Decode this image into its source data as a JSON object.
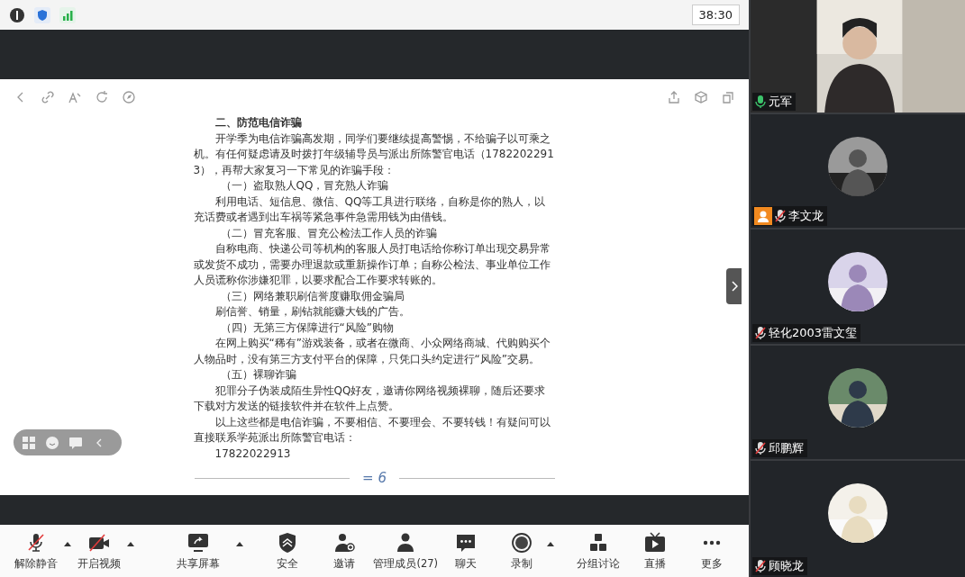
{
  "status_bar": {
    "timer": "38:30"
  },
  "document": {
    "paragraphs": [
      {
        "kind": "heading",
        "text": "二、防范电信诈骗"
      },
      {
        "kind": "body",
        "text": "开学季为电信诈骗高发期，同学们要继续提高警惕，不给骗子以可乘之机。有任何疑虑请及时拨打年级辅导员与派出所陈警官电话（17822022913），再帮大家复习一下常见的诈骗手段："
      },
      {
        "kind": "subheading",
        "text": "（一）盗取熟人QQ，冒充熟人诈骗"
      },
      {
        "kind": "body",
        "text": "利用电话、短信息、微信、QQ等工具进行联络，自称是你的熟人，以充话费或者遇到出车祸等紧急事件急需用钱为由借钱。"
      },
      {
        "kind": "subheading",
        "text": "（二）冒充客服、冒充公检法工作人员的诈骗"
      },
      {
        "kind": "body",
        "text": "自称电商、快递公司等机构的客服人员打电话给你称订单出现交易异常或发货不成功，需要办理退款或重新操作订单；自称公检法、事业单位工作人员谎称你涉嫌犯罪，以要求配合工作要求转账的。"
      },
      {
        "kind": "subheading",
        "text": "（三）网络兼职刷信誉度赚取佣金骗局"
      },
      {
        "kind": "plain",
        "text": "刷信誉、销量，刷钻就能赚大钱的广告。"
      },
      {
        "kind": "subheading",
        "text": "（四）无第三方保障进行“风险”购物"
      },
      {
        "kind": "body",
        "text": "在网上购买“稀有”游戏装备，或者在微商、小众网络商城、代购购买个人物品时，没有第三方支付平台的保障，只凭口头约定进行“风险”交易。"
      },
      {
        "kind": "subheading",
        "text": "（五）裸聊诈骗"
      },
      {
        "kind": "body",
        "text": "犯罪分子伪装成陌生异性QQ好友，邀请你网络视频裸聊，随后还要求下载对方发送的链接软件并在软件上点赞。"
      },
      {
        "kind": "body",
        "text": "以上这些都是电信诈骗，不要相信、不要理会、不要转钱！有疑问可以直接联系学苑派出所陈警官电话："
      },
      {
        "kind": "plain",
        "text": "17822022913"
      }
    ],
    "page_number": "= 6"
  },
  "toolbar": [
    {
      "kind": "button",
      "label": "解除静音"
    },
    {
      "kind": "caret"
    },
    {
      "kind": "button",
      "label": "开启视频"
    },
    {
      "kind": "caret"
    },
    {
      "kind": "button",
      "label": "共享屏幕"
    },
    {
      "kind": "caret"
    },
    {
      "kind": "button",
      "label": "安全"
    },
    {
      "kind": "button",
      "label": "邀请"
    },
    {
      "kind": "button",
      "label": "管理成员(27)"
    },
    {
      "kind": "button",
      "label": "聊天"
    },
    {
      "kind": "button",
      "label": "录制"
    },
    {
      "kind": "caret"
    },
    {
      "kind": "button",
      "label": "分组讨论"
    },
    {
      "kind": "button",
      "label": "直播"
    },
    {
      "kind": "button",
      "label": "更多"
    }
  ],
  "participants": [
    {
      "kind": "video",
      "name": "元军",
      "muted": false,
      "host": false
    },
    {
      "kind": "avatar",
      "name": "李文龙",
      "muted": true,
      "host": true
    },
    {
      "kind": "avatar",
      "name": "轻化2003雷文玺",
      "muted": true,
      "host": false
    },
    {
      "kind": "avatar",
      "name": "邱鹏辉",
      "muted": true,
      "host": false
    },
    {
      "kind": "avatar",
      "name": "顾晓龙",
      "muted": true,
      "host": false
    }
  ]
}
